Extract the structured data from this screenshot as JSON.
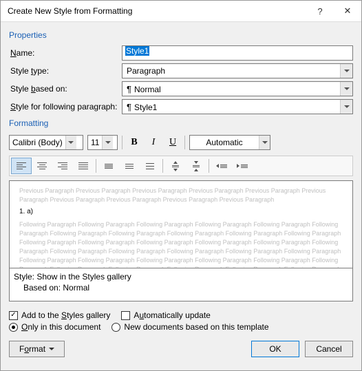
{
  "title": "Create New Style from Formatting",
  "sections": {
    "properties": "Properties",
    "formatting": "Formatting"
  },
  "props": {
    "name_label_pre": "",
    "name_u": "N",
    "name_label_post": "ame:",
    "name_value": "Style1",
    "type_label_pre": "Style ",
    "type_u": "t",
    "type_label_post": "ype:",
    "type_value": "Paragraph",
    "based_label_pre": "Style ",
    "based_u": "b",
    "based_label_post": "ased on:",
    "based_value": "Normal",
    "follow_label_pre": "",
    "follow_u": "S",
    "follow_label_post": "tyle for following paragraph:",
    "follow_value": "Style1"
  },
  "format": {
    "font": "Calibri (Body)",
    "size": "11",
    "color": "Automatic"
  },
  "preview": {
    "prev": "Previous Paragraph Previous Paragraph Previous Paragraph Previous Paragraph Previous Paragraph Previous Paragraph Previous Paragraph Previous Paragraph Previous Paragraph Previous Paragraph",
    "sample": "1.            a)",
    "follow": "Following Paragraph Following Paragraph Following Paragraph Following Paragraph Following Paragraph Following Paragraph Following Paragraph Following Paragraph Following Paragraph Following Paragraph Following Paragraph Following Paragraph Following Paragraph Following Paragraph Following Paragraph Following Paragraph Following Paragraph Following Paragraph Following Paragraph Following Paragraph Following Paragraph Following Paragraph Following Paragraph Following Paragraph Following Paragraph Following Paragraph Following Paragraph Following Paragraph Following Paragraph Following Paragraph Following Paragraph Following Paragraph Following Paragraph"
  },
  "desc": {
    "line1": "Style: Show in the Styles gallery",
    "line2": "Based on: Normal"
  },
  "checks": {
    "add_pre": "Add to the ",
    "add_u": "S",
    "add_post": "tyles gallery",
    "auto_pre": "A",
    "auto_u": "u",
    "auto_post": "tomatically update",
    "only_pre": "",
    "only_u": "O",
    "only_post": "nly in this document",
    "newdoc": "New documents based on this template"
  },
  "buttons": {
    "format_pre": "F",
    "format_u": "o",
    "format_post": "rmat",
    "ok": "OK",
    "cancel": "Cancel"
  }
}
